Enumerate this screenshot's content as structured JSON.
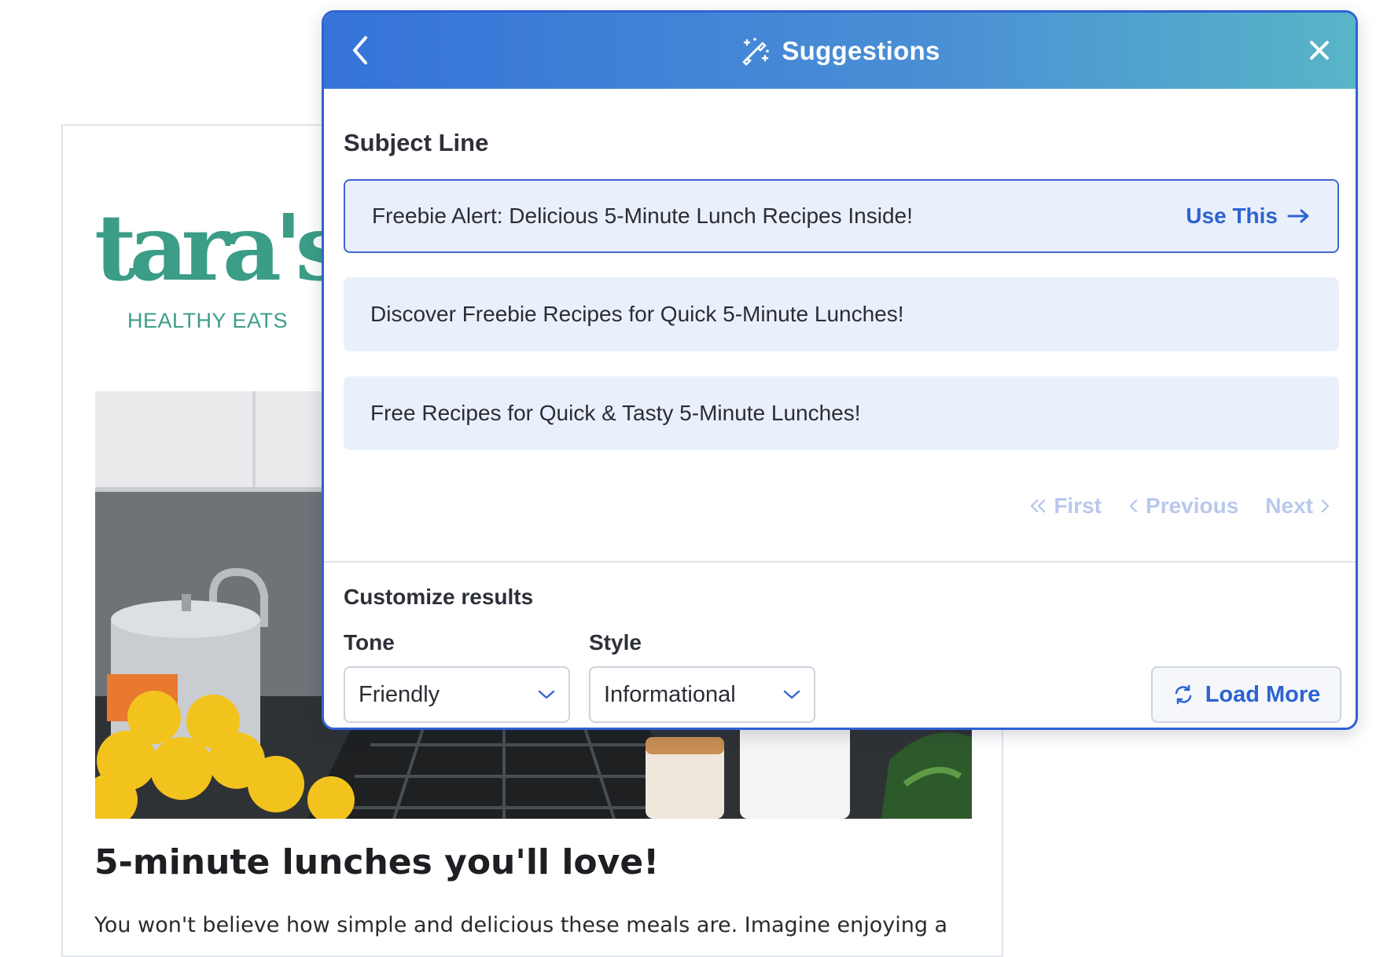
{
  "email": {
    "logo_main": "tara's",
    "logo_sub": "HEALTHY EATS",
    "heading": "5-minute lunches you'll love!",
    "body_text": "You won't believe how simple and delicious these meals are. Imagine enjoying a"
  },
  "panel": {
    "title": "Suggestions",
    "back_icon": "chevron-left-icon",
    "close_icon": "close-icon",
    "title_icon": "magic-wand-icon",
    "section_title": "Subject Line",
    "suggestions": [
      {
        "text": "Freebie Alert: Delicious 5-Minute Lunch Recipes Inside!",
        "selected": true
      },
      {
        "text": "Discover Freebie Recipes for Quick 5-Minute Lunches!",
        "selected": false
      },
      {
        "text": "Free Recipes for Quick & Tasty 5-Minute Lunches!",
        "selected": false
      }
    ],
    "use_this_label": "Use This",
    "pager": {
      "first": "First",
      "previous": "Previous",
      "next": "Next"
    },
    "customize_title": "Customize results",
    "tone": {
      "label": "Tone",
      "value": "Friendly"
    },
    "style": {
      "label": "Style",
      "value": "Informational"
    },
    "load_more_label": "Load More"
  },
  "colors": {
    "accent": "#2d63d2",
    "header_gradient_start": "#3573d9",
    "header_gradient_end": "#58b5c8",
    "suggestion_bg": "#eaf0fb",
    "pager_disabled": "#b9c8ec",
    "logo_green": "#3b9d86"
  }
}
